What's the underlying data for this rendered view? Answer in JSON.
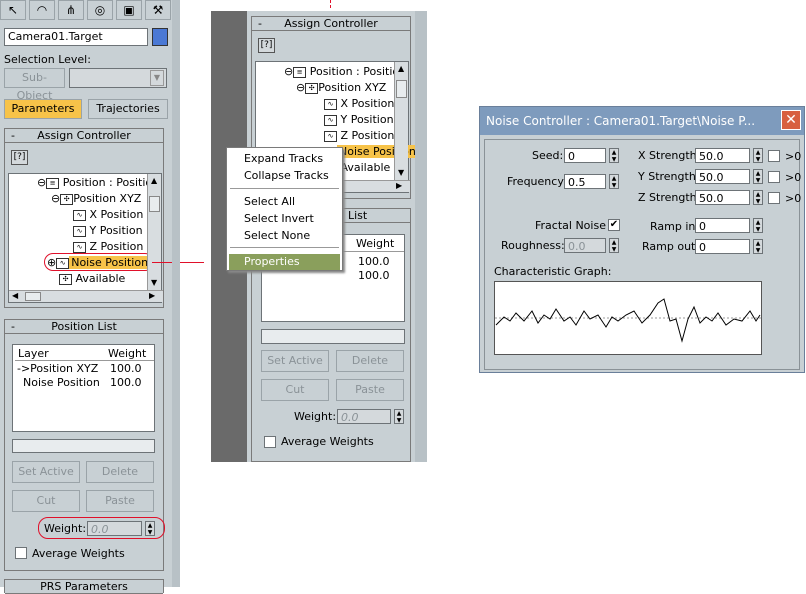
{
  "panel1": {
    "object_name": "Camera01.Target",
    "selection_level_label": "Selection Level:",
    "sub_object_label": "Sub-Object",
    "tabs": {
      "parameters": "Parameters",
      "trajectories": "Trajectories"
    },
    "assign_controller": {
      "title": "Assign Controller",
      "tree": [
        "Position : Position",
        "Position XYZ",
        "X Position",
        "Y Position",
        "Z Position",
        "Noise Position",
        "Available"
      ]
    },
    "position_list": {
      "title": "Position List",
      "columns": [
        "Layer",
        "Weight"
      ],
      "rows": [
        {
          "layer": "->Position XYZ",
          "weight": "100.0"
        },
        {
          "layer": "Noise Position",
          "weight": "100.0"
        }
      ],
      "set_active": "Set Active",
      "delete": "Delete",
      "cut": "Cut",
      "paste": "Paste",
      "weight_label": "Weight:",
      "weight_value": "0.0",
      "average_weights": "Average Weights"
    },
    "bottom_rollout": "PRS Parameters",
    "accent_color": "#f7c349",
    "highlight_color": "#e0102a"
  },
  "panel2": {
    "assign_controller": {
      "title": "Assign Controller",
      "tree": [
        "Position : Position",
        "Position XYZ",
        "X Position",
        "Y Position",
        "Z Position",
        "Noise Position",
        "Available"
      ]
    },
    "position_list": {
      "title_visible": "List",
      "weight_header": "Weight",
      "weights": [
        "100.0",
        "100.0"
      ],
      "set_active": "Set Active",
      "delete": "Delete",
      "cut": "Cut",
      "paste": "Paste",
      "weight_label": "Weight:",
      "weight_value": "0.0",
      "average_weights": "Average Weights"
    }
  },
  "context_menu": {
    "items": [
      "Expand Tracks",
      "Collapse Tracks",
      "Select All",
      "Select Invert",
      "Select None",
      "Properties"
    ],
    "selected": "Properties"
  },
  "noise_dialog": {
    "title": "Noise Controller : Camera01.Target\\Noise P...",
    "seed_label": "Seed:",
    "seed": "0",
    "frequency_label": "Frequency:",
    "frequency": "0.5",
    "x_strength_label": "X Strength:",
    "x_strength": "50.0",
    "y_strength_label": "Y Strength:",
    "y_strength": "50.0",
    "z_strength_label": "Z Strength:",
    "z_strength": "50.0",
    "gt0": ">0",
    "fractal_noise_label": "Fractal Noise",
    "fractal_noise_checked": true,
    "roughness_label": "Roughness:",
    "roughness": "0.0",
    "ramp_in_label": "Ramp in:",
    "ramp_in": "0",
    "ramp_out_label": "Ramp out:",
    "ramp_out": "0",
    "graph_label": "Characteristic Graph:"
  }
}
